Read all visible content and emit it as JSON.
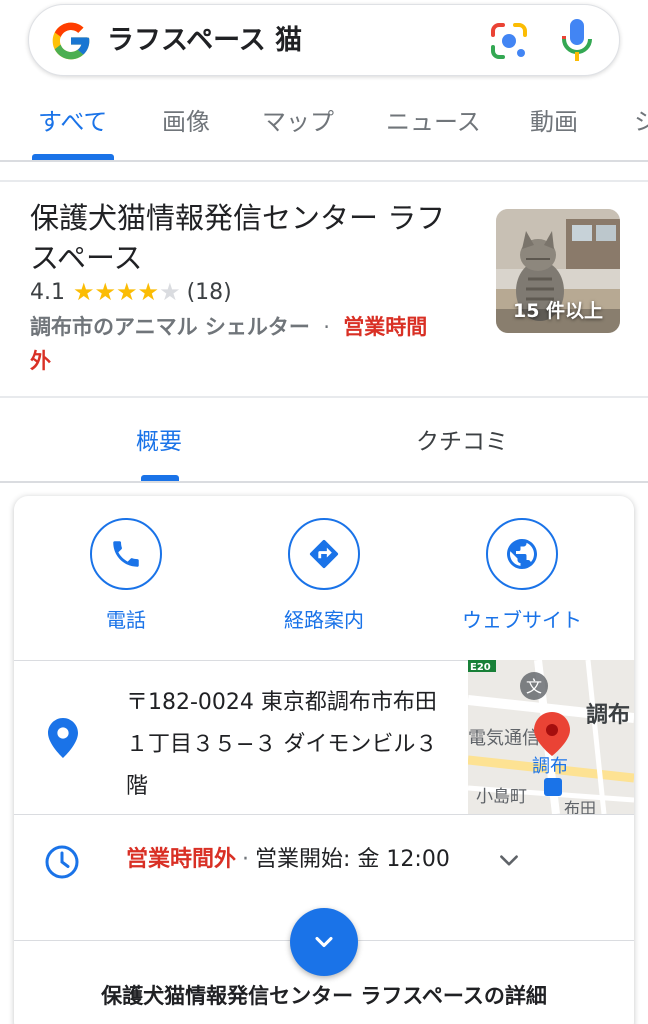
{
  "search": {
    "query": "ラフスペース 猫",
    "google_logo_icon": "google-g-icon",
    "lens_icon": "google-lens-icon",
    "mic_icon": "microphone-icon"
  },
  "tabs": [
    {
      "label": "すべて",
      "active": true
    },
    {
      "label": "画像"
    },
    {
      "label": "マップ"
    },
    {
      "label": "ニュース"
    },
    {
      "label": "動画"
    },
    {
      "label": "シ"
    }
  ],
  "place": {
    "title": "保護犬猫情報発信センター ラフスペース",
    "rating": "4.1",
    "stars_filled": 4,
    "stars_total": 5,
    "review_count": "(18)",
    "category": "調布市のアニマル シェルター",
    "separator": "·",
    "status": "営業時間外",
    "photo_count": "15 件以上"
  },
  "subtabs": [
    {
      "label": "概要",
      "active": true
    },
    {
      "label": "クチコミ"
    }
  ],
  "actions": [
    {
      "label": "電話",
      "icon": "phone-icon"
    },
    {
      "label": "経路案内",
      "icon": "directions-icon"
    },
    {
      "label": "ウェブサイト",
      "icon": "globe-icon"
    }
  ],
  "address": {
    "text": "〒182-0024 東京都調布市布田１丁目３５−３ ダイモンビル３階",
    "icon": "location-pin-icon",
    "map": {
      "label_chofu_large": "調布",
      "label_station": "調布",
      "label_area1": "電気通信大",
      "label_area2": "小島町",
      "label_route": "E20",
      "label_bottom": "布田"
    }
  },
  "hours": {
    "status": "営業時間外",
    "separator": "·",
    "opening": "営業開始: 金 12:00",
    "icon": "clock-icon"
  },
  "details_link": "保護犬猫情報発信センター ラフスペースの詳細",
  "colors": {
    "accent": "#1a73e8",
    "closed": "#d93025",
    "star": "#fbbc04"
  }
}
